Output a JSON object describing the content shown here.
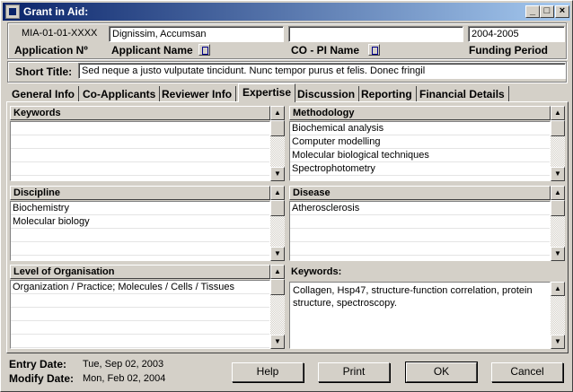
{
  "window": {
    "title": "Grant in Aid:"
  },
  "header": {
    "application_number": "MIA-01-01-XXXX",
    "application_number_label": "Application Nº",
    "applicant_name": "Dignissim, Accumsan",
    "applicant_name_label": "Applicant Name",
    "co_pi_name": "",
    "co_pi_label": "CO - PI Name",
    "funding_period": "2004-2005",
    "funding_period_label": "Funding Period",
    "short_title_label": "Short Title:",
    "short_title": "Sed neque a justo vulputate tincidunt. Nunc tempor purus et felis. Donec fringil"
  },
  "tabs": [
    {
      "label": "General Info"
    },
    {
      "label": "Co-Applicants"
    },
    {
      "label": "Reviewer Info"
    },
    {
      "label": "Expertise",
      "active": true
    },
    {
      "label": "Discussion"
    },
    {
      "label": "Reporting"
    },
    {
      "label": "Financial Details"
    }
  ],
  "panels": {
    "keywords": {
      "title": "Keywords",
      "items": []
    },
    "methodology": {
      "title": "Methodology",
      "items": [
        "Biochemical analysis",
        "Computer modelling",
        "Molecular biological techniques",
        "Spectrophotometry"
      ]
    },
    "discipline": {
      "title": "Discipline",
      "items": [
        "Biochemistry",
        "Molecular biology"
      ]
    },
    "disease": {
      "title": "Disease",
      "items": [
        "Atherosclerosis"
      ]
    },
    "level": {
      "title": "Level of Organisation",
      "items": [
        "Organization / Practice; Molecules / Cells / Tissues"
      ]
    },
    "keywords_text": {
      "title": "Keywords:",
      "text": "Collagen, Hsp47, structure-function correlation, protein structure, spectroscopy."
    }
  },
  "footer": {
    "entry_date_label": "Entry Date:",
    "entry_date": "Tue, Sep 02, 2003",
    "modify_date_label": "Modify Date:",
    "modify_date": "Mon, Feb 02, 2004"
  },
  "buttons": {
    "help": "Help",
    "print": "Print",
    "ok": "OK",
    "cancel": "Cancel"
  },
  "window_controls": {
    "minimize": "_",
    "maximize": "□",
    "close": "×"
  }
}
